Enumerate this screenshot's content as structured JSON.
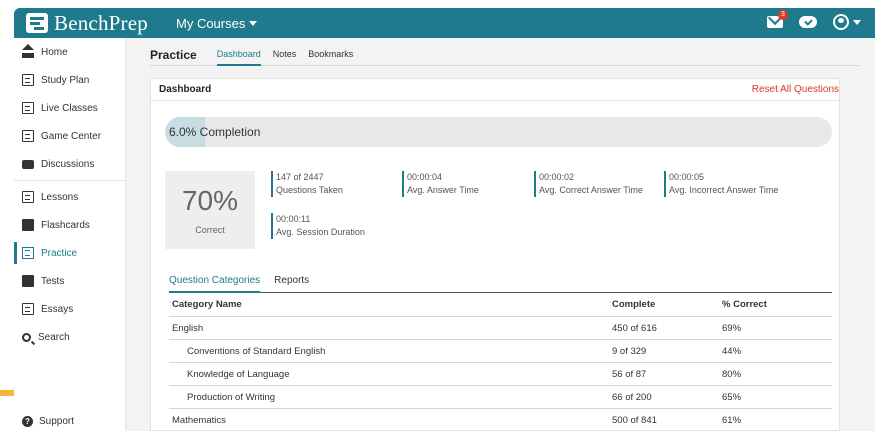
{
  "brand": {
    "name": "BenchPrep"
  },
  "topbar": {
    "courses_label": "My Courses",
    "notification_count": "3"
  },
  "sidebar": {
    "items": [
      {
        "label": "Home",
        "icon": "home-icon"
      },
      {
        "label": "Study Plan",
        "icon": "study-plan-icon"
      },
      {
        "label": "Live Classes",
        "icon": "live-classes-icon"
      },
      {
        "label": "Game Center",
        "icon": "game-center-icon"
      },
      {
        "label": "Discussions",
        "icon": "discussions-icon"
      },
      {
        "label": "Lessons",
        "icon": "lessons-icon"
      },
      {
        "label": "Flashcards",
        "icon": "flashcards-icon"
      },
      {
        "label": "Practice",
        "icon": "practice-icon"
      },
      {
        "label": "Tests",
        "icon": "tests-icon"
      },
      {
        "label": "Essays",
        "icon": "essays-icon"
      },
      {
        "label": "Search",
        "icon": "search-icon"
      }
    ],
    "support_label": "Support"
  },
  "practice": {
    "title": "Practice",
    "tabs": [
      "Dashboard",
      "Notes",
      "Bookmarks"
    ]
  },
  "dashboard": {
    "title": "Dashboard",
    "reset_label": "Reset All Questions",
    "completion_label": "6.0% Completion",
    "completion_fraction": 0.06,
    "score_pct": "70%",
    "score_label": "Correct",
    "stats": [
      {
        "value": "147 of 2447",
        "label": "Questions Taken"
      },
      {
        "value": "00:00:04",
        "label": "Avg. Answer Time"
      },
      {
        "value": "00:00:02",
        "label": "Avg. Correct Answer Time"
      },
      {
        "value": "00:00:05",
        "label": "Avg. Incorrect Answer Time"
      },
      {
        "value": "00:00:11",
        "label": "Avg. Session Duration"
      }
    ]
  },
  "categories": {
    "tabs": [
      "Question Categories",
      "Reports"
    ],
    "headers": [
      "Category Name",
      "Complete",
      "% Correct"
    ],
    "rows": [
      {
        "name": "English",
        "complete": "450 of 616",
        "correct": "69%"
      },
      {
        "name": "Conventions of Standard English",
        "complete": "9 of 329",
        "correct": "44%"
      },
      {
        "name": "Knowledge of Language",
        "complete": "56 of 87",
        "correct": "80%"
      },
      {
        "name": "Production of Writing",
        "complete": "66 of 200",
        "correct": "65%"
      },
      {
        "name": "Mathematics",
        "complete": "500 of 841",
        "correct": "61%"
      }
    ]
  }
}
